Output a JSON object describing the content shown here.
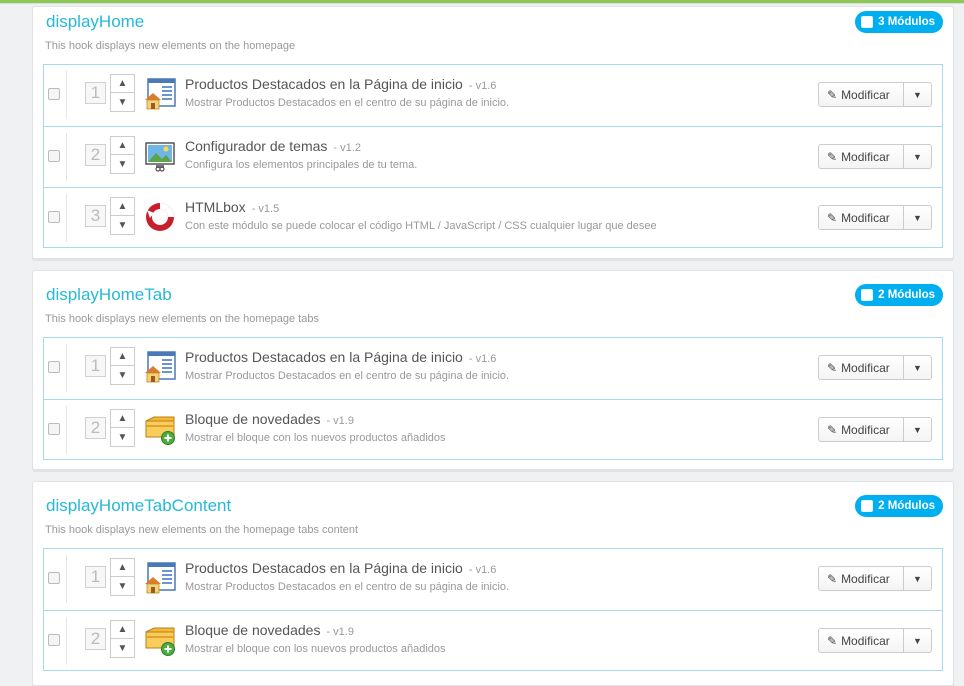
{
  "hooks": [
    {
      "title": "displayHome",
      "description": "This hook displays new elements on the homepage",
      "badge": "3 Módulos",
      "modules": [
        {
          "position": "1",
          "name": "Productos Destacados en la Página de inicio",
          "version": "- v1.6",
          "description": "Mostrar Productos Destacados en el centro de su página de inicio.",
          "icon": "featured-products-icon",
          "button": "Modificar"
        },
        {
          "position": "2",
          "name": "Configurador de temas",
          "version": "- v1.2",
          "description": "Configura los elementos principales de tu tema.",
          "icon": "theme-configurator-icon",
          "button": "Modificar"
        },
        {
          "position": "3",
          "name": "HTMLbox",
          "version": "- v1.5",
          "description": "Con este módulo se puede colocar el código HTML / JavaScript / CSS cualquier lugar que desee",
          "icon": "htmlbox-icon",
          "button": "Modificar"
        }
      ]
    },
    {
      "title": "displayHomeTab",
      "description": "This hook displays new elements on the homepage tabs",
      "badge": "2 Módulos",
      "modules": [
        {
          "position": "1",
          "name": "Productos Destacados en la Página de inicio",
          "version": "- v1.6",
          "description": "Mostrar Productos Destacados en el centro de su página de inicio.",
          "icon": "featured-products-icon",
          "button": "Modificar"
        },
        {
          "position": "2",
          "name": "Bloque de novedades",
          "version": "- v1.9",
          "description": "Mostrar el bloque con los nuevos productos añadidos",
          "icon": "new-products-box-icon",
          "button": "Modificar"
        }
      ]
    },
    {
      "title": "displayHomeTabContent",
      "description": "This hook displays new elements on the homepage tabs content",
      "badge": "2 Módulos",
      "modules": [
        {
          "position": "1",
          "name": "Productos Destacados en la Página de inicio",
          "version": "- v1.6",
          "description": "Mostrar Productos Destacados en el centro de su página de inicio.",
          "icon": "featured-products-icon",
          "button": "Modificar"
        },
        {
          "position": "2",
          "name": "Bloque de novedades",
          "version": "- v1.9",
          "description": "Mostrar el bloque con los nuevos productos añadidos",
          "icon": "new-products-box-icon",
          "button": "Modificar"
        }
      ]
    }
  ],
  "colors": {
    "accent": "#25b9d7",
    "badge": "#00aff0",
    "topbar": "#8bc954",
    "row_border": "#a7d8ec"
  }
}
